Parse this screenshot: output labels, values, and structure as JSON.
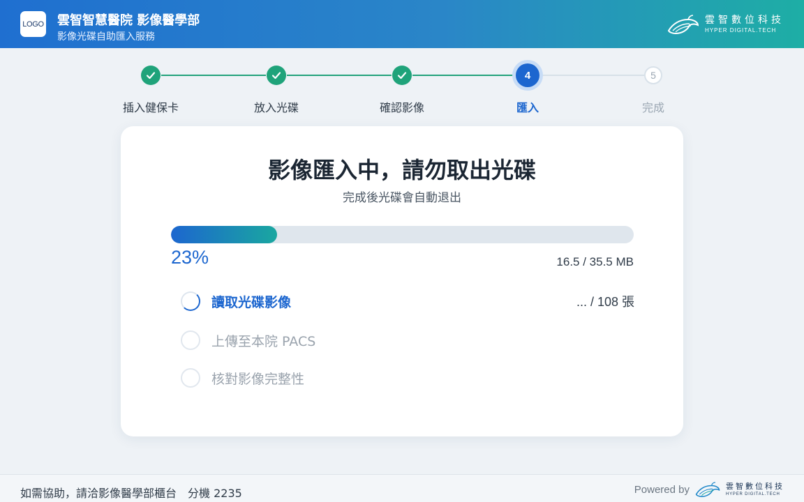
{
  "header": {
    "logo_text": "LOGO",
    "hospital_name": "雲智智慧醫院 影像醫學部",
    "service_name": "影像光碟自助匯入服務",
    "brand_cn": "雲智數位科技",
    "brand_en": "HYPER DIGITAL.TECH"
  },
  "stepper": {
    "steps": [
      {
        "label": "插入健保卡",
        "status": "done",
        "icon": "check-icon"
      },
      {
        "label": "放入光碟",
        "status": "done",
        "icon": "check-icon"
      },
      {
        "label": "確認影像",
        "status": "done",
        "icon": "check-icon"
      },
      {
        "label": "匯入",
        "status": "current",
        "number": "4"
      },
      {
        "label": "完成",
        "status": "todo",
        "number": "5"
      }
    ]
  },
  "card": {
    "title": "影像匯入中，請勿取出光碟",
    "subtitle": "完成後光碟會自動退出",
    "progress": {
      "percent": 23,
      "percent_label": "23%",
      "size_label": "16.5 / 35.5 MB"
    },
    "tasks": [
      {
        "label": "讀取光碟影像",
        "status": "active",
        "count": "... / 108 張",
        "icon": "spinner-icon"
      },
      {
        "label": "上傳至本院 PACS",
        "status": "pending",
        "count": "",
        "icon": "circle-icon"
      },
      {
        "label": "核對影像完整性",
        "status": "pending",
        "count": "",
        "icon": "circle-icon"
      }
    ]
  },
  "footer": {
    "help_text": "如需協助，請洽影像醫學部櫃台　分機 2235",
    "powered_label": "Powered by",
    "brand_cn": "雲智數位科技",
    "brand_en": "HYPER DIGITAL.TECH"
  },
  "colors": {
    "primary": "#1c66cf",
    "success": "#1fa37a",
    "accent": "#1aa7a0"
  }
}
